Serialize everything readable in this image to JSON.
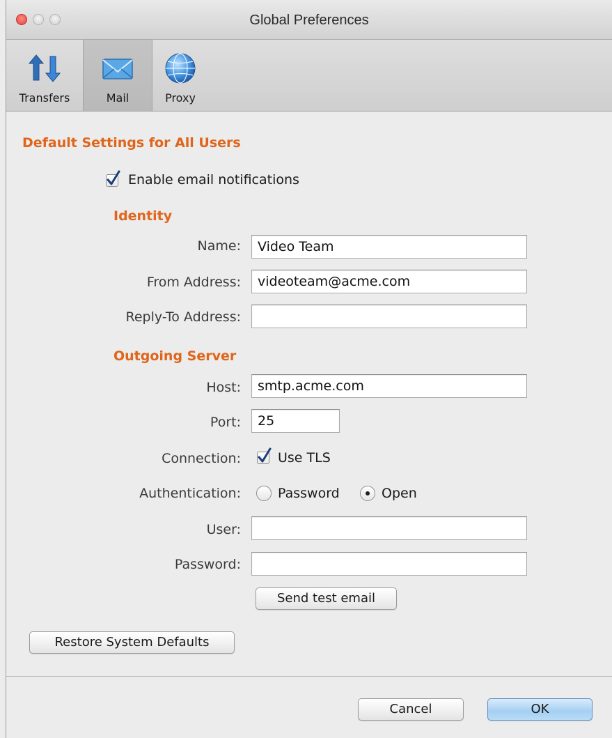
{
  "window": {
    "title": "Global Preferences"
  },
  "toolbar": {
    "items": [
      {
        "label": "Transfers",
        "icon": "transfers-icon",
        "selected": false
      },
      {
        "label": "Mail",
        "icon": "mail-icon",
        "selected": true
      },
      {
        "label": "Proxy",
        "icon": "globe-icon",
        "selected": false
      }
    ]
  },
  "content": {
    "section_title": "Default Settings for All Users",
    "enable_notifications": {
      "label": "Enable email notifications",
      "checked": true
    },
    "identity": {
      "title": "Identity",
      "name_label": "Name:",
      "name_value": "Video Team",
      "from_label": "From Address:",
      "from_value": "videoteam@acme.com",
      "reply_label": "Reply-To Address:",
      "reply_value": ""
    },
    "server": {
      "title": "Outgoing Server",
      "host_label": "Host:",
      "host_value": "smtp.acme.com",
      "port_label": "Port:",
      "port_value": "25",
      "connection_label": "Connection:",
      "tls_label": "Use TLS",
      "tls_checked": true,
      "auth_label": "Authentication:",
      "auth_options": [
        "Password",
        "Open"
      ],
      "auth_selected": "Open",
      "user_label": "User:",
      "user_value": "",
      "password_label": "Password:",
      "password_value": ""
    },
    "send_test_label": "Send test email",
    "restore_label": "Restore System Defaults"
  },
  "footer": {
    "cancel_label": "Cancel",
    "ok_label": "OK"
  },
  "colors": {
    "section_accent": "#e0651a",
    "default_button": "#a5cff2",
    "close_button": "#e0443e"
  }
}
